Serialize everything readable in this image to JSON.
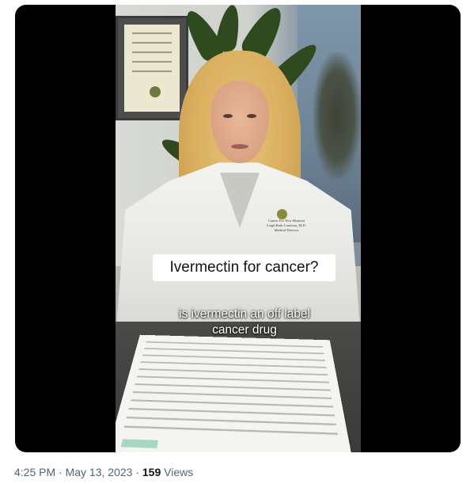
{
  "video": {
    "title_caption": "Ivermectin for cancer?",
    "subtitle_line1": "is ivermectin an off label",
    "subtitle_line2": "cancer drug",
    "coat_embroidery": [
      "Cancer For New Moment",
      "Leigh Ruth Comerny, M.D.",
      "Medical Director"
    ]
  },
  "tweet_meta": {
    "time": "4:25 PM",
    "separator1": " · ",
    "date": "May 13, 2023",
    "separator2": " · ",
    "views_count": "159",
    "views_label": " Views"
  },
  "colors": {
    "meta_text": "#536471",
    "views_count": "#0f1419",
    "video_bg": "#000000"
  }
}
